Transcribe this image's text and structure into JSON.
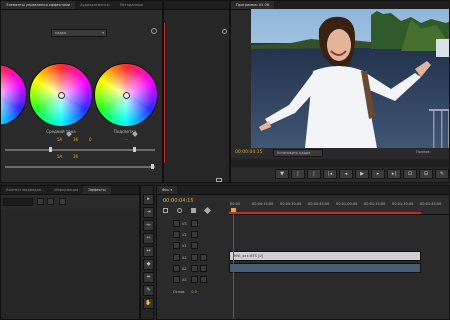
{
  "effects_panel": {
    "tabs": [
      "Элементы управления эффектами",
      "Аудиоэлементы",
      "Метаданные"
    ],
    "top_field_value": "кадра",
    "wheel_labels": [
      "",
      "Средний тона",
      "Подсветка"
    ],
    "values": [
      "5A",
      "36",
      "0"
    ],
    "preset_label": "...",
    "lower_values": [
      "5A",
      "36"
    ]
  },
  "program_monitor": {
    "tabs": [
      "Программа: 05 08"
    ],
    "timecode": "00:00:04:15",
    "fit_dropdown": "Установить кадра",
    "full_label": "Полное"
  },
  "project_panel": {
    "tabs": [
      "Контент медиадан...",
      "Информация",
      "Эффекты"
    ]
  },
  "timeline": {
    "tab": "Фкк ▾",
    "timecode": "00:00:04:15",
    "ruler": [
      "00:00",
      "00:00:15:00",
      "00:00:30:00",
      "00:00:45:00",
      "00:01:00:00",
      "00:01:15:00",
      "00:01:30:00",
      "00:01:45:00"
    ],
    "video_tracks": [
      "V3",
      "V2",
      "V1"
    ],
    "audio_tracks": [
      "A1",
      "A2",
      "A3"
    ],
    "master_label": "Основ.",
    "master_value": "0.0",
    "clip_name": "MVI_xxx.MTS [V]",
    "colors": {
      "video_clip": "#cfcfd4",
      "audio_clip": "#4a5c74",
      "playhead": "#cc2a2a"
    }
  }
}
